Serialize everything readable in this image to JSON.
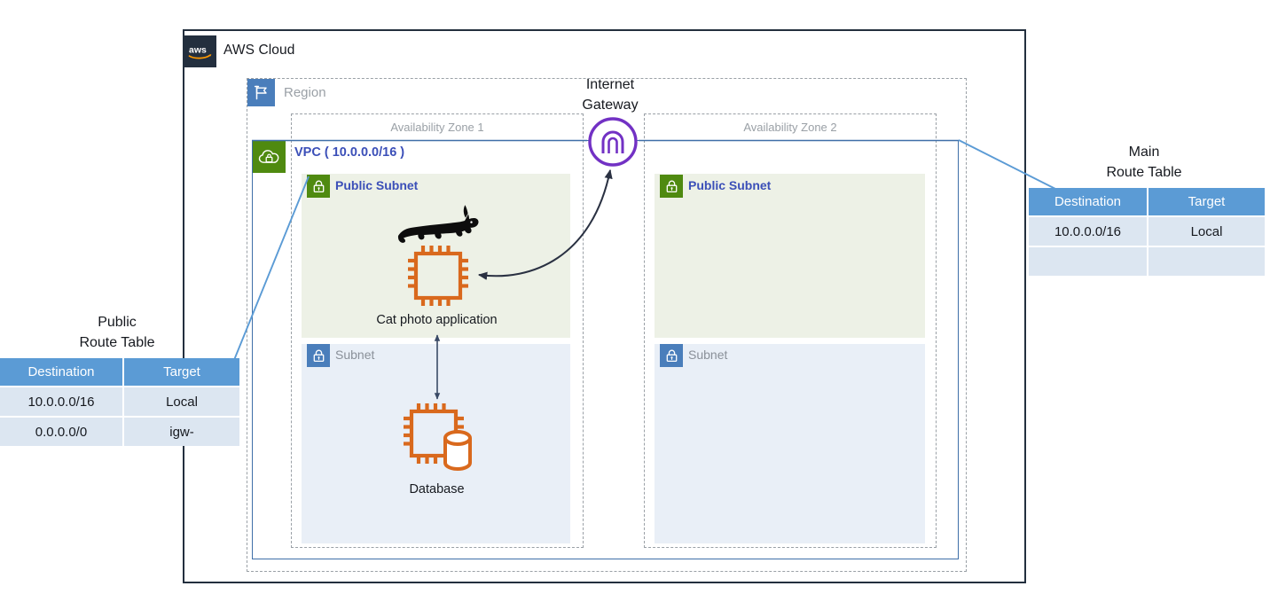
{
  "cloud": {
    "title": "AWS Cloud",
    "logo_icon": "aws-logo-icon"
  },
  "region": {
    "title": "Region",
    "icon": "region-flag-icon"
  },
  "vpc": {
    "title": "VPC  ( 10.0.0.0/16 )",
    "icon": "vpc-cloud-lock-icon",
    "cidr": "10.0.0.0/16"
  },
  "availability_zones": [
    {
      "title": "Availability Zone 1"
    },
    {
      "title": "Availability Zone 2"
    }
  ],
  "subnets": {
    "az1_public": {
      "label": "Public Subnet",
      "icon": "subnet-lock-icon"
    },
    "az1_private": {
      "label": "Subnet",
      "icon": "subnet-lock-icon"
    },
    "az2_public": {
      "label": "Public Subnet",
      "icon": "subnet-lock-icon"
    },
    "az2_private": {
      "label": "Subnet",
      "icon": "subnet-lock-icon"
    }
  },
  "internet_gateway": {
    "line1": "Internet",
    "line2": "Gateway",
    "icon": "internet-gateway-icon"
  },
  "resources": {
    "app": {
      "caption": "Cat photo application",
      "icon": "ec2-instance-icon",
      "mascot_icon": "running-cat-icon"
    },
    "database": {
      "caption": "Database",
      "icon": "database-instance-icon"
    }
  },
  "route_tables": {
    "public": {
      "title_line1": "Public",
      "title_line2": "Route Table",
      "columns": [
        "Destination",
        "Target"
      ],
      "rows": [
        [
          "10.0.0.0/16",
          "Local"
        ],
        [
          "0.0.0.0/0",
          "igw-"
        ]
      ]
    },
    "main": {
      "title_line1": "Main",
      "title_line2": "Route Table",
      "columns": [
        "Destination",
        "Target"
      ],
      "rows": [
        [
          "10.0.0.0/16",
          "Local"
        ],
        [
          "",
          ""
        ]
      ]
    }
  },
  "colors": {
    "aws_navy": "#232f3e",
    "region_blue": "#4a7ebb",
    "vpc_green": "#4f8a10",
    "vpc_border_blue": "#3f6fa8",
    "subnet_public_fill": "#edf1e6",
    "subnet_private_fill": "#e9eff7",
    "label_blue": "#3b4fb8",
    "igw_purple": "#7231c4",
    "instance_orange": "#d9691d",
    "table_header_blue": "#5b9bd5",
    "table_row_blue": "#dce6f1",
    "connector_blue": "#5b9bd5",
    "dashed_gray": "#9aa0a6"
  }
}
